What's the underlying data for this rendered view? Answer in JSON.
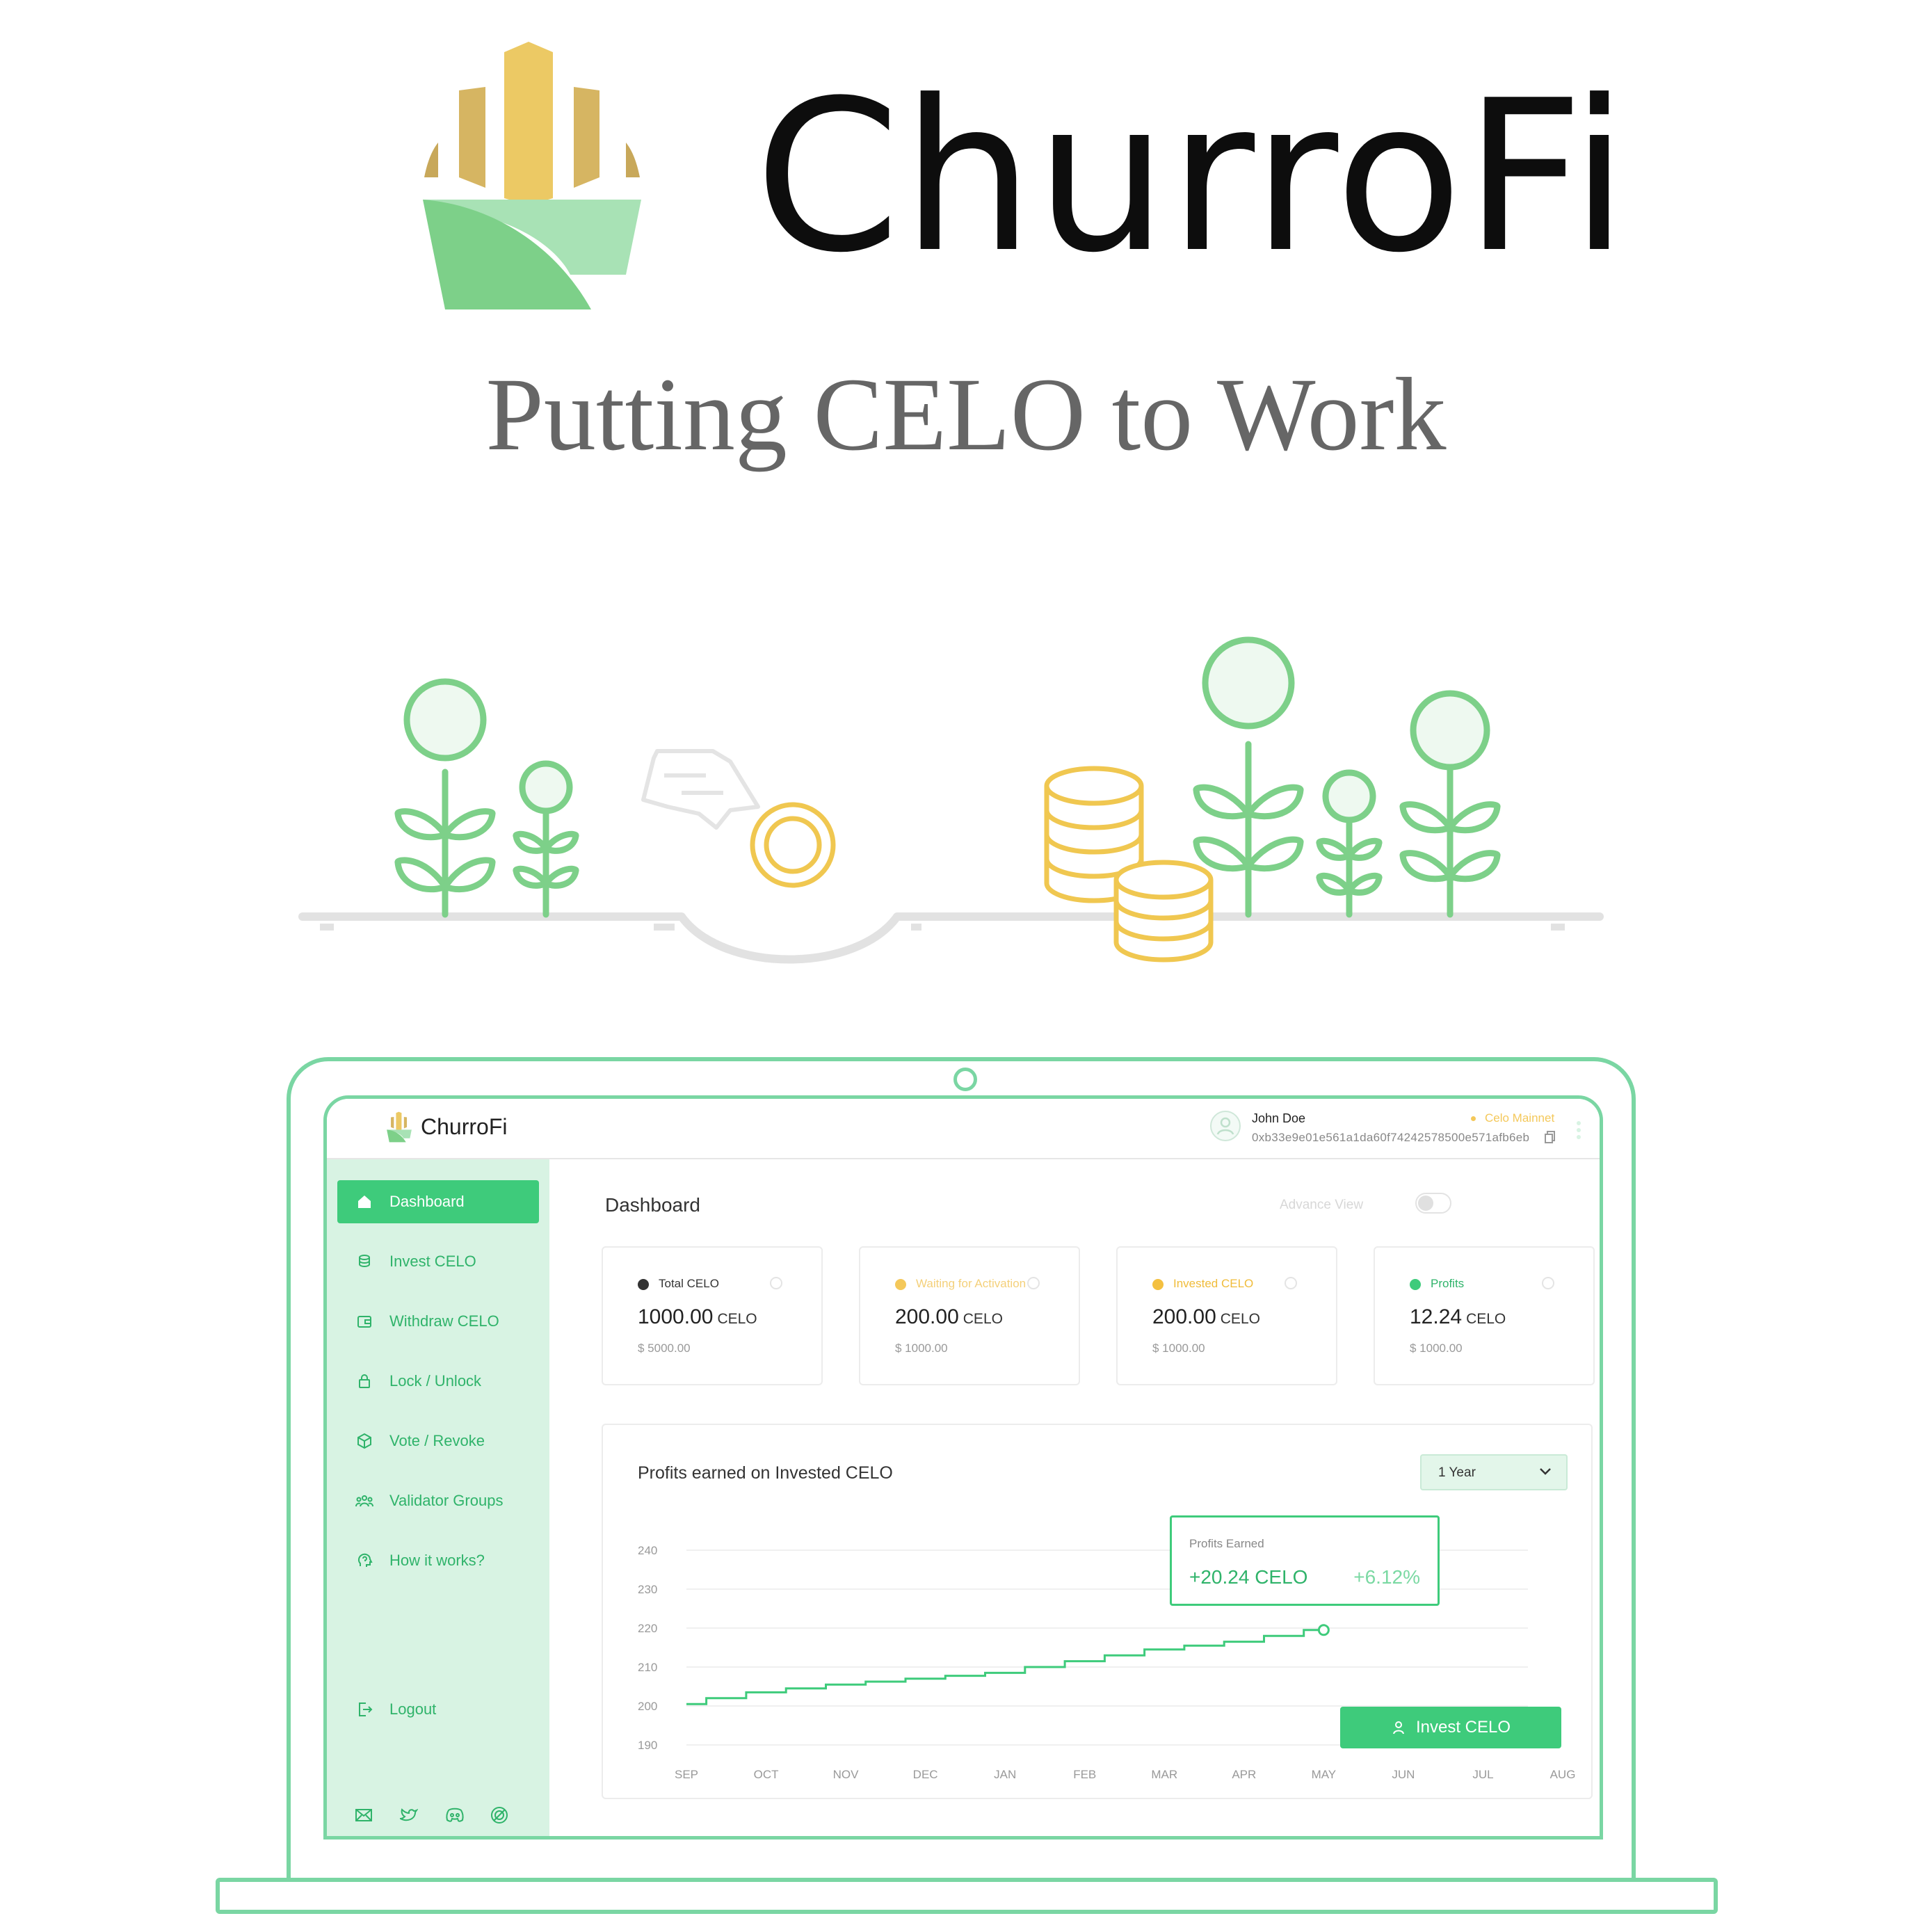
{
  "hero": {
    "brand_name": "ChurroFi",
    "tagline": "Putting CELO to Work"
  },
  "app": {
    "logo_text": "ChurroFi",
    "user": {
      "name": "John Doe",
      "address": "0xb33e9e01e561a1da60f74242578500e571afb6eb",
      "network": "Celo Mainnet"
    },
    "sidebar": {
      "items": [
        {
          "label": "Dashboard",
          "icon": "home-icon",
          "active": true
        },
        {
          "label": "Invest CELO",
          "icon": "coins-icon",
          "active": false
        },
        {
          "label": "Withdraw CELO",
          "icon": "wallet-icon",
          "active": false
        },
        {
          "label": "Lock / Unlock",
          "icon": "lock-icon",
          "active": false
        },
        {
          "label": "Vote / Revoke",
          "icon": "cube-icon",
          "active": false
        },
        {
          "label": "Validator Groups",
          "icon": "group-icon",
          "active": false
        },
        {
          "label": "How it works?",
          "icon": "help-icon",
          "active": false
        }
      ],
      "logout_label": "Logout",
      "social_icons": [
        "mail-icon",
        "twitter-icon",
        "discord-icon",
        "link-icon"
      ]
    },
    "main": {
      "title": "Dashboard",
      "advance_view_label": "Advance View",
      "stats": [
        {
          "label": "Total CELO",
          "amount": "1000.00",
          "unit": "CELO",
          "usd": "$ 5000.00",
          "color": "#333333"
        },
        {
          "label": "Waiting for Activation",
          "amount": "200.00",
          "unit": "CELO",
          "usd": "$ 1000.00",
          "color": "#f4c85a"
        },
        {
          "label": "Invested CELO",
          "amount": "200.00",
          "unit": "CELO",
          "usd": "$ 1000.00",
          "color": "#f4c040"
        },
        {
          "label": "Profits",
          "amount": "12.24",
          "unit": "CELO",
          "usd": "$ 1000.00",
          "color": "#3ecb7b"
        }
      ],
      "chart_title": "Profits earned on Invested CELO",
      "range": "1 Year",
      "tooltip": {
        "label": "Profits Earned",
        "value": "+20.24 CELO",
        "percent": "+6.12%"
      },
      "invest_button": "Invest CELO"
    }
  },
  "colors": {
    "accent": "#3ecb7b",
    "sidebar_bg": "#d8f3e3",
    "laptop_outline": "#7ad6a3",
    "gold": "#f0c750"
  },
  "chart_data": {
    "type": "line",
    "x": [
      "SEP",
      "OCT",
      "NOV",
      "DEC",
      "JAN",
      "FEB",
      "MAR",
      "APR",
      "MAY",
      "JUN",
      "JUL",
      "AUG"
    ],
    "series": [
      {
        "values": [
          200.5,
          203.5,
          205.5,
          207,
          208.5,
          211.5,
          214.5,
          216.5,
          219.5
        ]
      }
    ],
    "yticks": [
      190,
      200,
      210,
      220,
      230,
      240
    ],
    "ylim": [
      190,
      240
    ],
    "grid": true
  }
}
